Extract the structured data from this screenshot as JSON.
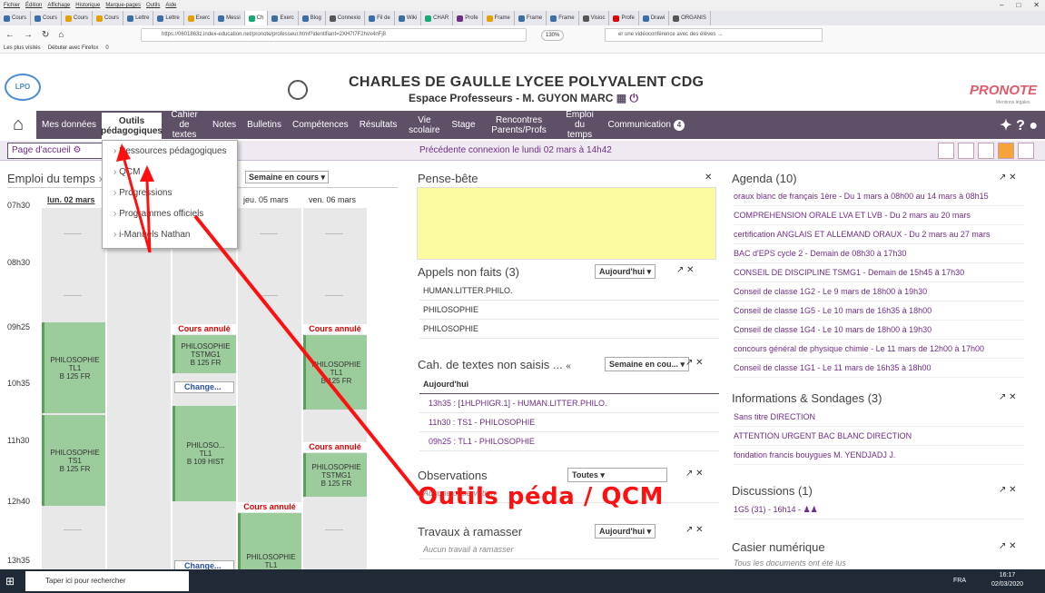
{
  "browser": {
    "menus": [
      "Fichier",
      "Édition",
      "Affichage",
      "Historique",
      "Marque-pages",
      "Outils",
      "Aide"
    ],
    "tabs": [
      "Cours",
      "Cours",
      "Cours",
      "Cours",
      "Lettre",
      "Lettre",
      "Exerc",
      "Messi",
      "Ch",
      "Exerc",
      "Blog",
      "Connexio",
      "Fil de",
      "Wiki",
      "CHAR",
      "Profe",
      "Frame",
      "Frame",
      "Frame",
      "Visioc",
      "Profe",
      "Drawi",
      "ORGANIS"
    ],
    "url": "https://0601863z.index-education.net/pronote/professeur.html?identifiant=2XH7t7F2hvx4nFj8",
    "zoom": "130%",
    "search_placeholder": "er une vidéoconférence avec des élèves →",
    "bookmarks": [
      "Les plus visités",
      "Débuter avec Firefox",
      "0"
    ]
  },
  "header": {
    "logo": "LPO",
    "school": "CHARLES DE GAULLE LYCEE POLYVALENT CDG",
    "espace": "Espace Professeurs - M. GUYON MARC",
    "brand": "PRONOTE",
    "brand_sub": "Mentions légales"
  },
  "nav": {
    "items": [
      {
        "label": "Mes données"
      },
      {
        "label": "Outils pédagogiques"
      },
      {
        "label": "Cahier de textes"
      },
      {
        "label": "Notes"
      },
      {
        "label": "Bulletins"
      },
      {
        "label": "Compétences"
      },
      {
        "label": "Résultats"
      },
      {
        "label": "Vie scolaire"
      },
      {
        "label": "Stage"
      },
      {
        "label": "Rencontres Parents/Profs"
      },
      {
        "label": "Emploi du temps"
      },
      {
        "label": "Communication"
      }
    ],
    "notif_count": "4"
  },
  "subbar": {
    "home": "Page d'accueil",
    "previous_connection": "Précédente connexion le lundi 02 mars à 14h42"
  },
  "dropdown": {
    "items": [
      "Ressources pédagogiques",
      "QCM",
      "Progressions",
      "Programmes officiels",
      "i-Manuels Nathan"
    ]
  },
  "timetable": {
    "title": "Emploi du temps",
    "week": "Semaine en cours",
    "days": [
      "lun. 02 mars",
      "",
      "",
      "jeu. 05 mars",
      "ven. 06 mars"
    ],
    "times": [
      "07h30",
      "08h30",
      "09h25",
      "10h35",
      "11h30",
      "12h40",
      "13h35"
    ],
    "cancelled": "Cours annulé",
    "change": "Change...",
    "courses": [
      {
        "l1": "PHILOSOPHIE",
        "l2": "TL1",
        "l3": "B 125 FR"
      },
      {
        "l1": "PHILOSOPHIE",
        "l2": "TS1",
        "l3": "B 125 FR"
      },
      {
        "l1": "PHILOSOPHIE",
        "l2": "TSTMG1",
        "l3": "B 125 FR"
      },
      {
        "l1": "PHILOSO...",
        "l2": "TL1",
        "l3": "B 109 HIST"
      },
      {
        "l1": "PHILOSOPHIE",
        "l2": "TL1",
        "l3": ""
      },
      {
        "l1": "PHILOSOPHIE",
        "l2": "TL1",
        "l3": "B 125 FR"
      },
      {
        "l1": "PHILOSOPHIE",
        "l2": "TSTMG1",
        "l3": "B 125 FR"
      }
    ]
  },
  "pense_bete": {
    "title": "Pense-bête"
  },
  "appels": {
    "title": "Appels non faits (3)",
    "filter": "Aujourd'hui",
    "rows": [
      "HUMAN.LITTER.PHILO.",
      "PHILOSOPHIE",
      "PHILOSOPHIE"
    ]
  },
  "cahier": {
    "title": "Cah. de textes non saisis ...",
    "filter": "Semaine en cou...",
    "sub": "Aujourd'hui",
    "rows": [
      "13h35 : [1HLPHIGR.1] - HUMAN.LITTER.PHILO.",
      "11h30 : TS1 - PHILOSOPHIE",
      "09h25 : TL1 - PHILOSOPHIE"
    ]
  },
  "observations": {
    "title": "Observations",
    "filter": "Toutes",
    "empty": "Aucune observation"
  },
  "travaux": {
    "title": "Travaux à ramasser",
    "filter": "Aujourd'hui",
    "empty": "Aucun travail à ramasser"
  },
  "agenda": {
    "title": "Agenda (10)",
    "rows": [
      "oraux blanc de français 1ère - Du 1 mars à 08h00 au 14 mars à 08h15",
      "COMPREHENSION ORALE LVA ET LVB - Du 2 mars au 20 mars",
      "certification ANGLAIS ET ALLEMAND ORAUX - Du 2 mars au 27 mars",
      "BAC d'EPS cycle 2 - Demain de 08h30 à 17h30",
      "CONSEIL DE DISCIPLINE TSMG1 - Demain de 15h45 à 17h30",
      "Conseil de classe 1G2 - Le 9 mars de 18h00 à 19h30",
      "Conseil de classe 1G5 - Le 10 mars de 16h35 à 18h00",
      "Conseil de classe 1G4 - Le 10 mars de 18h00 à 19h30",
      "concours général de physique chimie - Le 11 mars de 12h00 à 17h00",
      "Conseil de classe 1G1 - Le 11 mars de 16h35 à 18h00"
    ]
  },
  "infos": {
    "title": "Informations & Sondages (3)",
    "rows": [
      "Sans titre DIRECTION",
      "ATTENTION URGENT BAC BLANC DIRECTION",
      "fondation francis bouygues M. YENDJADJ J."
    ]
  },
  "discussions": {
    "title": "Discussions (1)",
    "rows": [
      "1G5 (31) - 16h14 -"
    ]
  },
  "casier": {
    "title": "Casier numérique",
    "empty": "Tous les documents ont été lus"
  },
  "annotation": "Outils péda / QCM",
  "taskbar": {
    "search": "Taper ici pour rechercher",
    "time": "16:17",
    "date": "02/03/2020",
    "lang": "FRA"
  },
  "colors": {
    "nav": "#5d5067",
    "accent": "#6f2e86",
    "course": "#9ccb9c",
    "annotation": "#ff1010"
  }
}
